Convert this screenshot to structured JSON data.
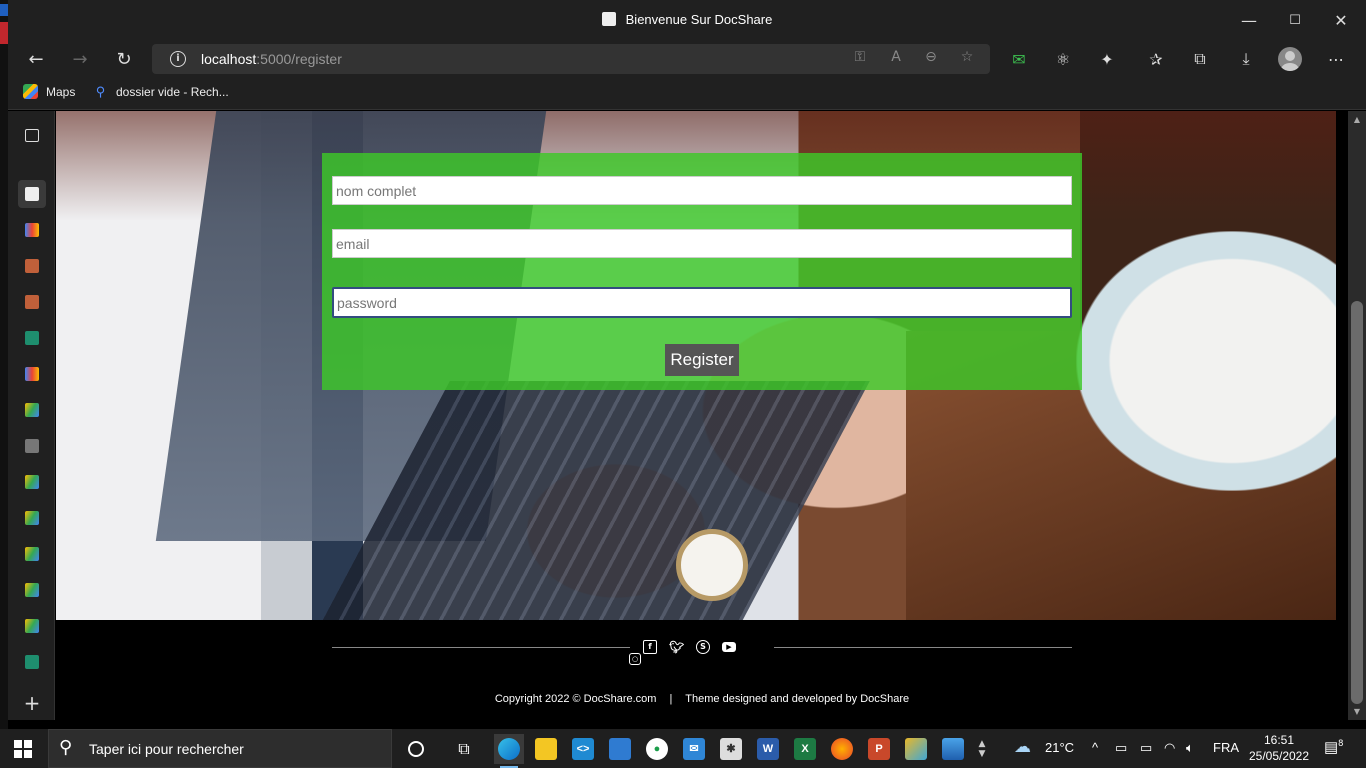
{
  "window": {
    "title": "Bienvenue Sur DocShare",
    "minimize": "—",
    "maximize": "☐",
    "close": "✕"
  },
  "toolbar": {
    "url_host": "localhost",
    "url_path": ":5000/register"
  },
  "favorites": {
    "items": [
      {
        "label": "Maps",
        "icon": "maps-icon"
      },
      {
        "label": "dossier vide - Rech...",
        "icon": "search-icon"
      }
    ]
  },
  "form": {
    "name_placeholder": "nom complet",
    "email_placeholder": "email",
    "password_placeholder": "password",
    "register_label": "Register",
    "panel_color": "#3dc828"
  },
  "footer": {
    "copyright": "Copyright 2022 © DocShare.com",
    "separator": "|",
    "credit": "Theme designed and developed by DocShare",
    "social": [
      "facebook-icon",
      "twitter-icon",
      "skype-icon",
      "youtube-icon",
      "instagram-icon"
    ]
  },
  "taskbar": {
    "search_placeholder": "Taper ici pour rechercher",
    "weather": "21°C",
    "language": "FRA",
    "time": "16:51",
    "date": "25/05/2022",
    "notification_count": "8",
    "apps": [
      "edge",
      "file-explorer",
      "vscode",
      "store",
      "evernote",
      "mail",
      "app",
      "word",
      "excel",
      "firefox",
      "powerpoint",
      "app2",
      "photos"
    ]
  }
}
